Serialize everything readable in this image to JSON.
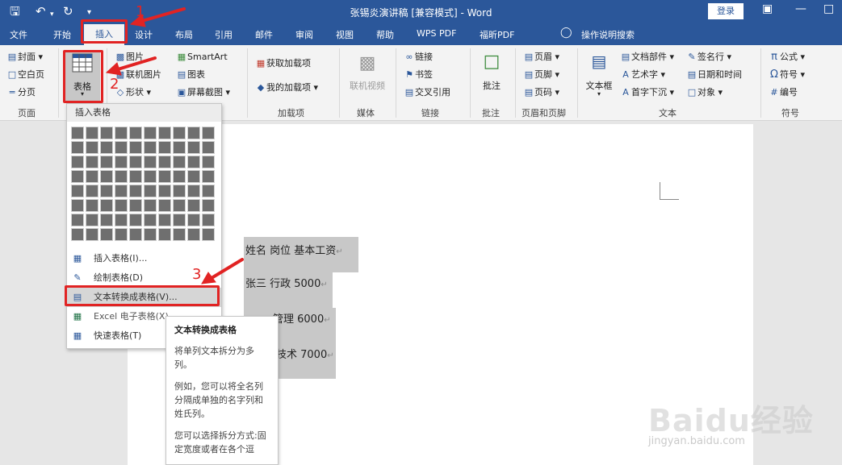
{
  "titlebar": {
    "title": "张锡炎演讲稿 [兼容模式] - Word",
    "login": "登录",
    "icons": [
      "save-icon",
      "undo-icon",
      "redo-icon",
      "customize-icon"
    ]
  },
  "tabs": [
    "文件",
    "开始",
    "插入",
    "设计",
    "布局",
    "引用",
    "邮件",
    "审阅",
    "视图",
    "帮助",
    "WPS PDF",
    "福昕PDF"
  ],
  "tellme": "操作说明搜索",
  "ribbon": {
    "pages": {
      "cover": "封面",
      "blank": "空白页",
      "break": "分页",
      "group": "页面"
    },
    "tables": {
      "table": "表格"
    },
    "illus": {
      "picture": "图片",
      "online_picture": "联机图片",
      "shapes": "形状",
      "smartart": "SmartArt",
      "chart": "图表",
      "screenshot": "屏幕截图"
    },
    "addins": {
      "get": "获取加载项",
      "mine": "我的加载项",
      "group": "加载项"
    },
    "media": {
      "video": "联机视频",
      "group": "媒体"
    },
    "links": {
      "link": "链接",
      "bookmark": "书签",
      "crossref": "交叉引用",
      "group": "链接"
    },
    "comments": {
      "comment": "批注",
      "group": "批注"
    },
    "hf": {
      "header": "页眉",
      "footer": "页脚",
      "pagenum": "页码",
      "group": "页眉和页脚"
    },
    "text": {
      "textbox": "文本框",
      "quickparts": "文档部件",
      "wordart": "艺术字",
      "dropcap": "首字下沉",
      "signature": "签名行",
      "datetime": "日期和时间",
      "object": "对象",
      "group": "文本"
    },
    "symbols": {
      "equation": "公式",
      "symbol": "符号",
      "number": "编号",
      "group": "符号"
    }
  },
  "dropdown": {
    "header": "插入表格",
    "items": [
      {
        "label": "插入表格(I)..."
      },
      {
        "label": "绘制表格(D)"
      },
      {
        "label": "文本转换成表格(V)..."
      },
      {
        "label": "Excel 电子表格(X)"
      },
      {
        "label": "快速表格(T)"
      }
    ]
  },
  "tooltip": {
    "title": "文本转换成表格",
    "p1": "将单列文本拆分为多列。",
    "p2": "例如，您可以将全名列分隔成单独的名字列和姓氏列。",
    "p3": "您可以选择拆分方式:固定宽度或者在各个逗"
  },
  "document": {
    "rows": [
      "姓名 岗位 基本工资",
      "张三 行政 5000",
      "管理 6000",
      "技术 7000"
    ],
    "para_mark": "↵"
  },
  "annotations": [
    "1",
    "2",
    "3"
  ],
  "watermark": {
    "logo": "Baidu经验",
    "url": "jingyan.baidu.com"
  }
}
